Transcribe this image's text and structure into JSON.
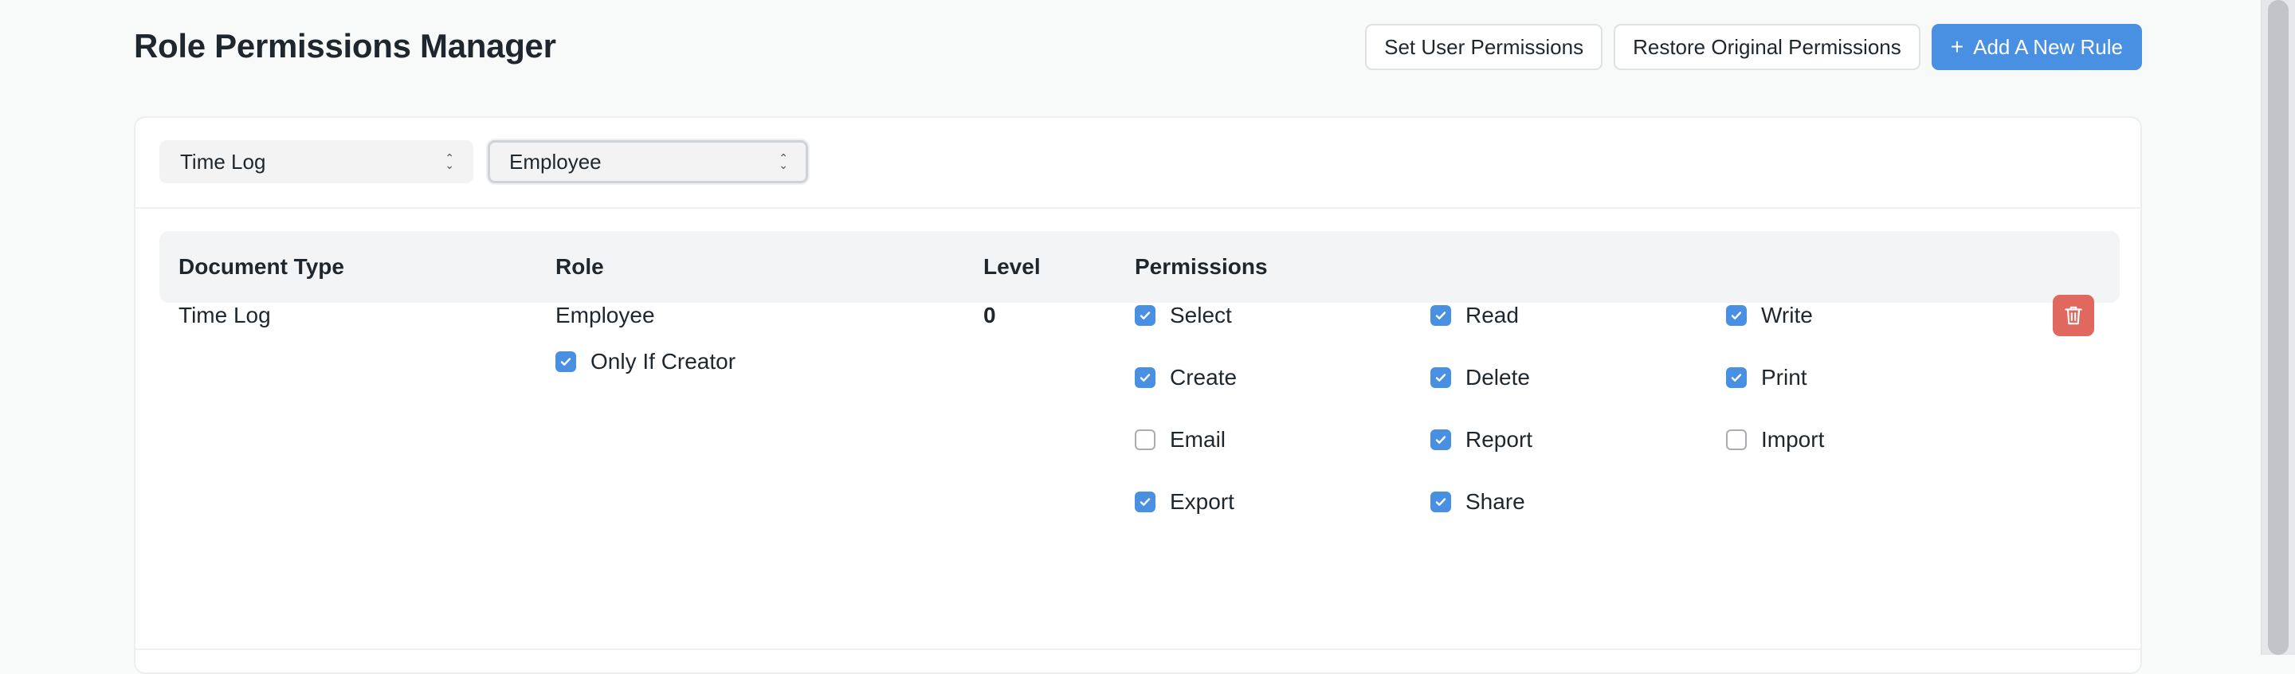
{
  "page": {
    "title": "Role Permissions Manager",
    "actions": {
      "set_user_permissions": "Set User Permissions",
      "restore_original": "Restore Original Permissions",
      "add_rule": "Add A New Rule",
      "add_rule_icon": "+"
    }
  },
  "filters": {
    "document_type": "Time Log",
    "role": "Employee"
  },
  "table": {
    "headers": {
      "document_type": "Document Type",
      "role": "Role",
      "level": "Level",
      "permissions": "Permissions"
    },
    "row": {
      "document_type": "Time Log",
      "role": "Employee",
      "level": "0",
      "only_if_creator": {
        "label": "Only If Creator",
        "checked": true
      },
      "permissions": [
        {
          "label": "Select",
          "checked": true
        },
        {
          "label": "Read",
          "checked": true
        },
        {
          "label": "Write",
          "checked": true
        },
        {
          "label": "Create",
          "checked": true
        },
        {
          "label": "Delete",
          "checked": true
        },
        {
          "label": "Print",
          "checked": true
        },
        {
          "label": "Email",
          "checked": false
        },
        {
          "label": "Report",
          "checked": true
        },
        {
          "label": "Import",
          "checked": false
        },
        {
          "label": "Export",
          "checked": true
        },
        {
          "label": "Share",
          "checked": true
        }
      ]
    }
  },
  "colors": {
    "primary": "#4a90e2",
    "danger": "#e0685e",
    "text": "#1f272e",
    "header_bg": "#f3f4f5"
  },
  "icons": {
    "delete": "trash-icon",
    "select_caret": "chevron-updown-icon",
    "check": "check-icon"
  }
}
